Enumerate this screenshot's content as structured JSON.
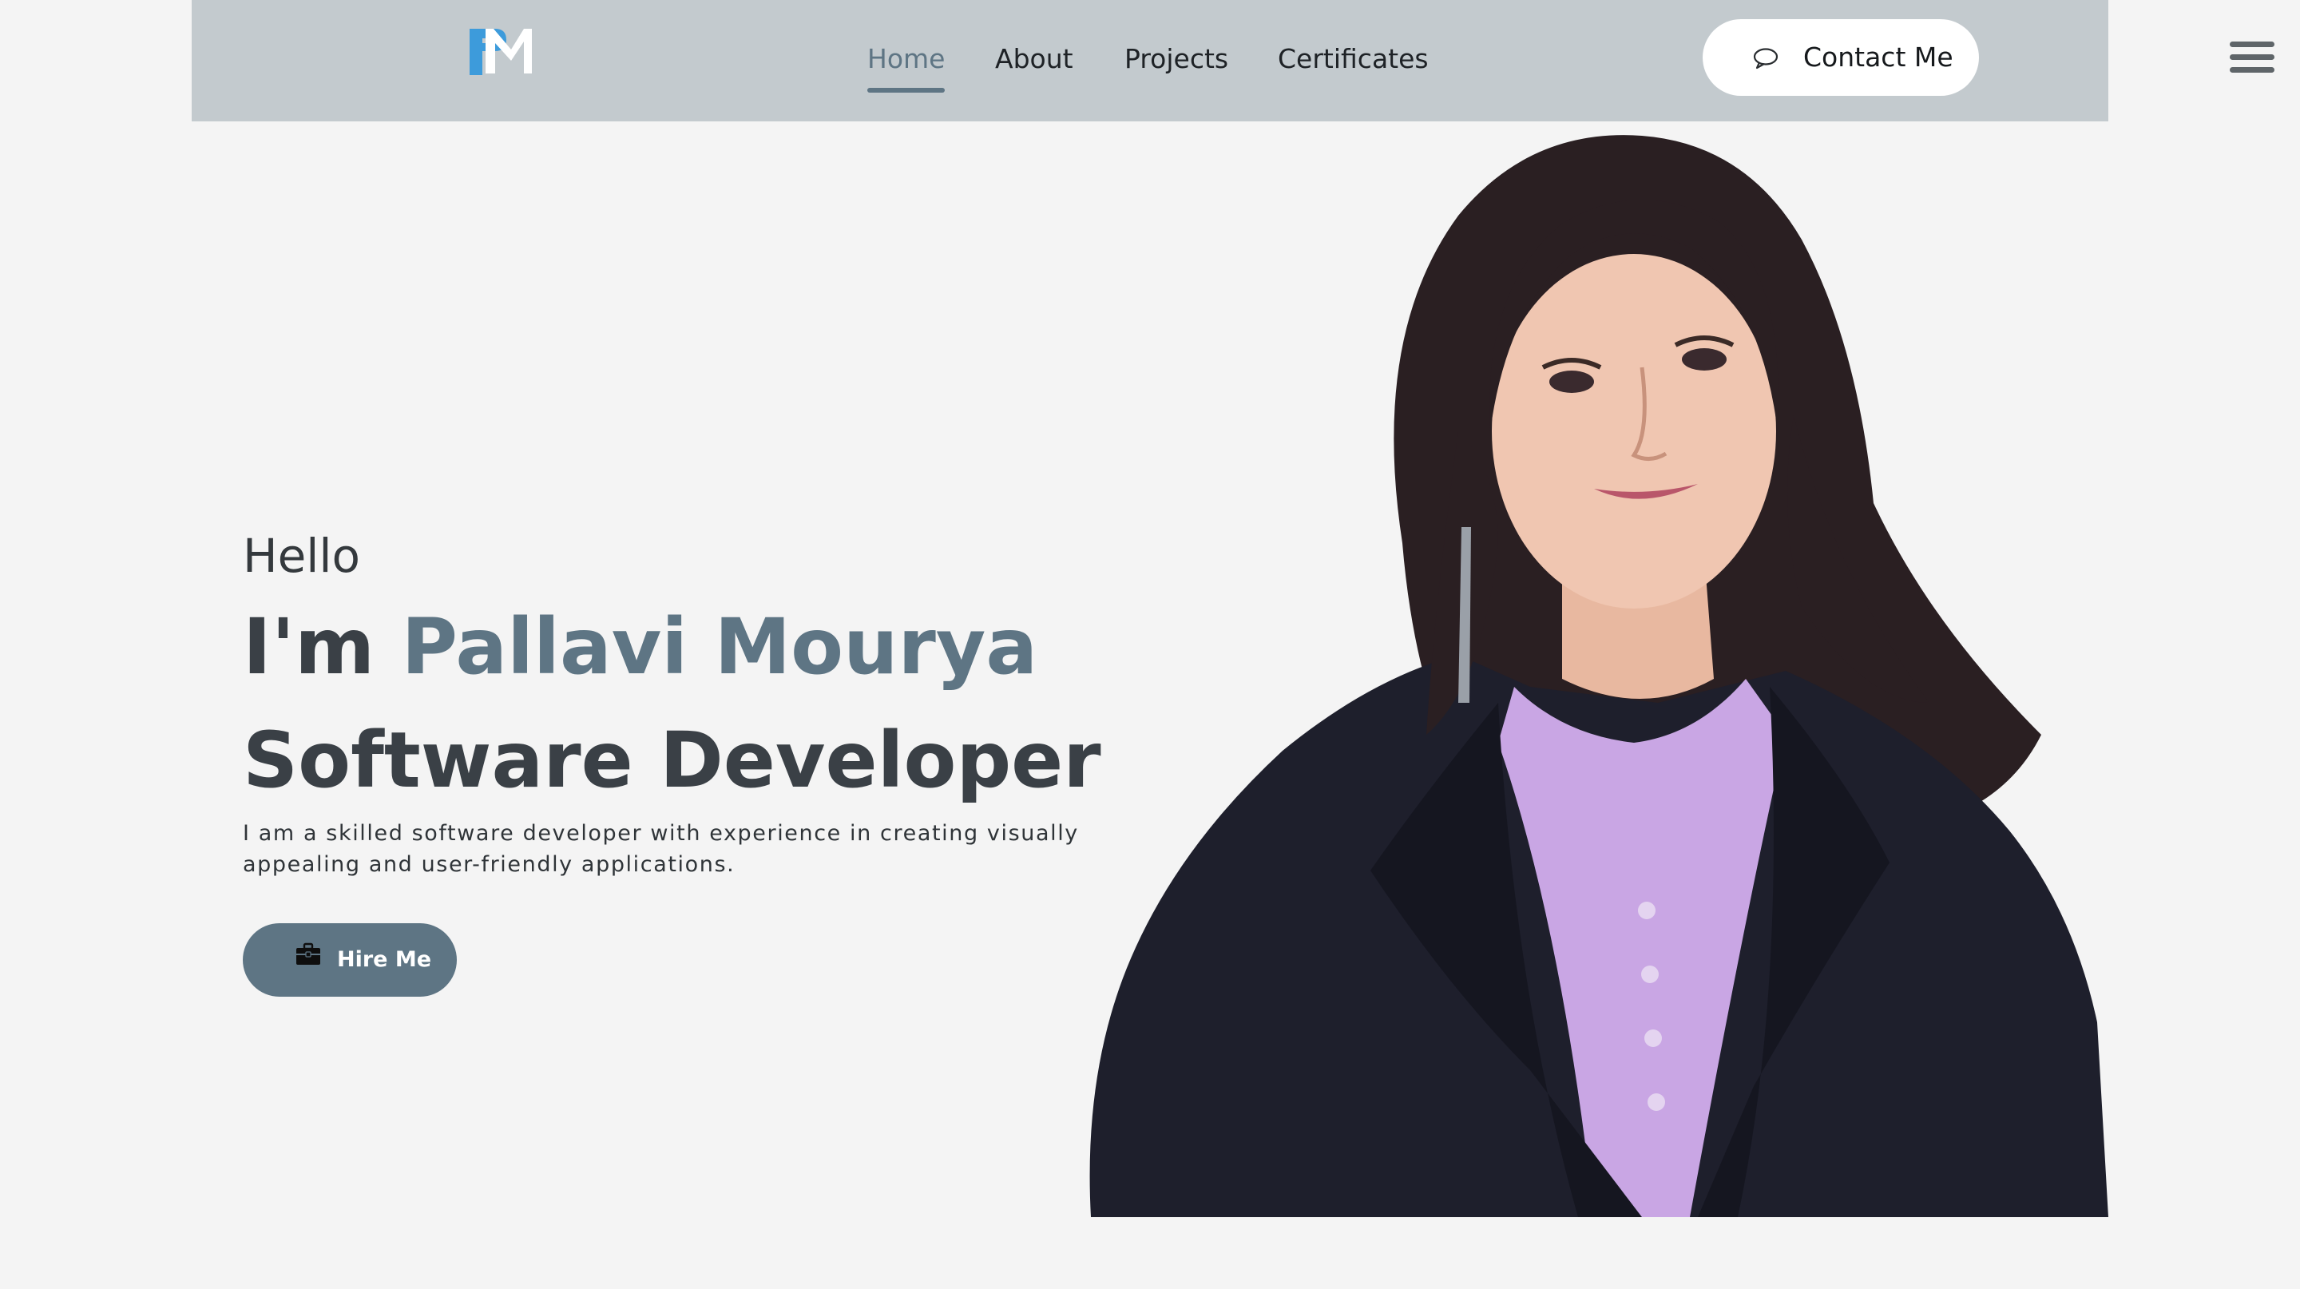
{
  "header": {
    "logo_text": "PM",
    "nav": [
      {
        "label": "Home",
        "active": true
      },
      {
        "label": "About",
        "active": false
      },
      {
        "label": "Projects",
        "active": false
      },
      {
        "label": "Certificates",
        "active": false
      }
    ],
    "contact_button": {
      "label": "Contact Me",
      "icon": "chat-bubble-icon"
    },
    "menu_icon": "hamburger-menu-icon"
  },
  "hero": {
    "greeting": "Hello",
    "intro_prefix": "I'm ",
    "name": "Pallavi Mourya",
    "role": "Software Developer",
    "description": "I am a skilled software developer with experience in creating visually appealing and user-friendly applications.",
    "hire_button": {
      "label": "Hire Me",
      "icon": "briefcase-icon"
    }
  },
  "portrait": {
    "icon": "person-portrait"
  },
  "colors": {
    "accent": "#5e7584",
    "header_bg": "#c3cace",
    "page_bg": "#f4f4f4",
    "text_dark": "#3a4046",
    "logo_blue": "#3d9bdb"
  }
}
